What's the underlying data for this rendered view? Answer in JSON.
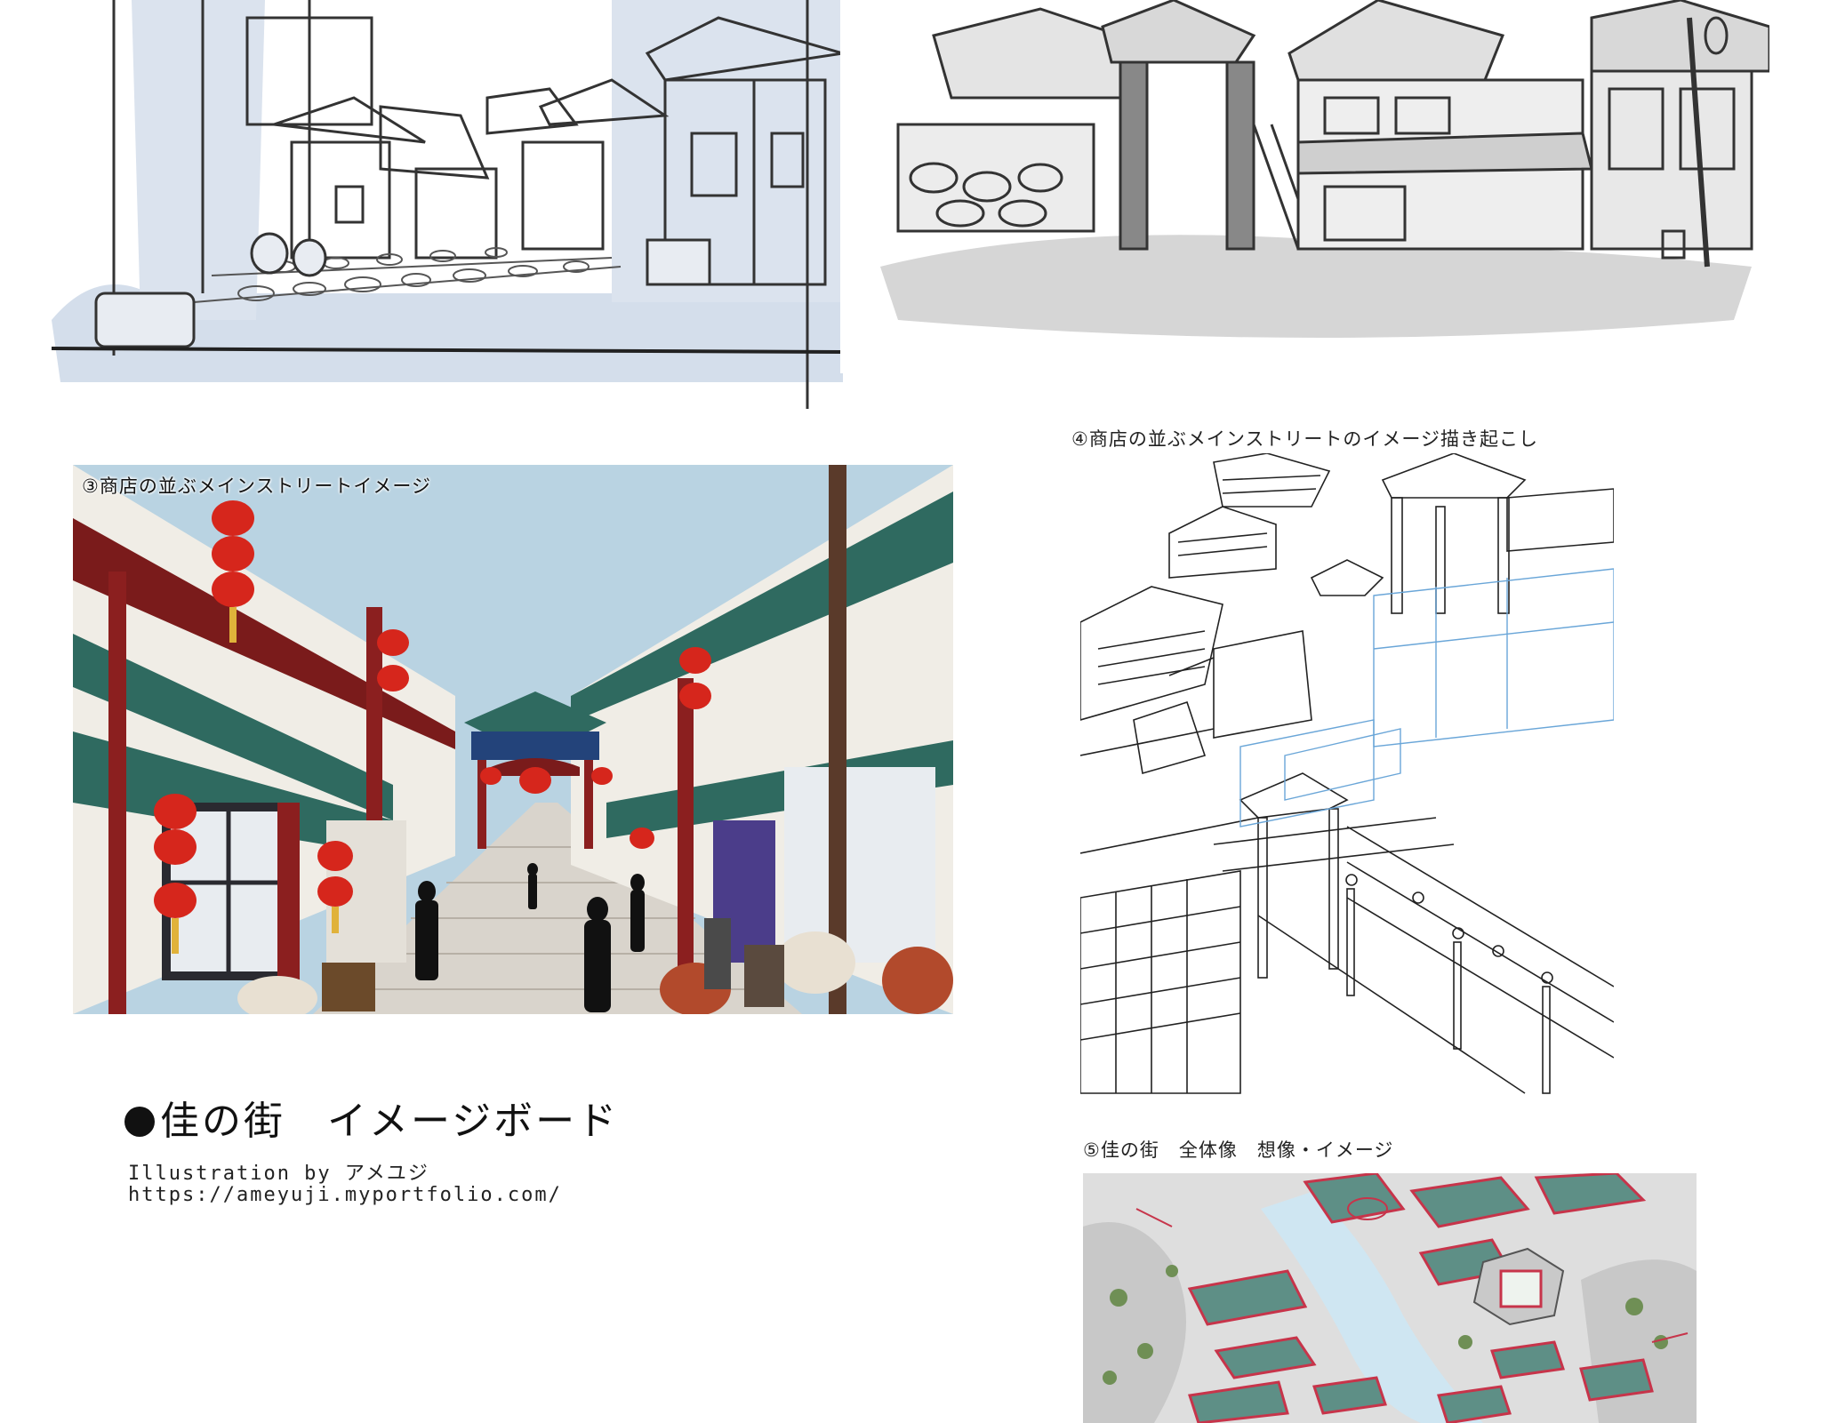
{
  "panels": {
    "street_sketch_1": {
      "caption": ""
    },
    "plaza_sketch_2": {
      "caption": ""
    },
    "color_street_3": {
      "caption": "③商店の並ぶメインストリートイメージ"
    },
    "lineart_4": {
      "caption": "④商店の並ぶメインストリートのイメージ描き起こし"
    },
    "town_map_5": {
      "caption": "⑤佳の街　全体像　想像・イメージ"
    }
  },
  "board": {
    "title": "佳の街　イメージボード",
    "credit": "Illustration by アメユジ",
    "url": "https://ameyuji.myportfolio.com/"
  },
  "colors": {
    "lantern_red": "#d6261c",
    "roof_teal": "#2f6a60",
    "pillar_red": "#8b1f1f",
    "sky_blue": "#b9d3e2",
    "sketch_blue": "#c9d6e6",
    "sketch_gray": "#9a9a9a",
    "map_green": "#5e8f86",
    "map_red": "#c7344a"
  }
}
